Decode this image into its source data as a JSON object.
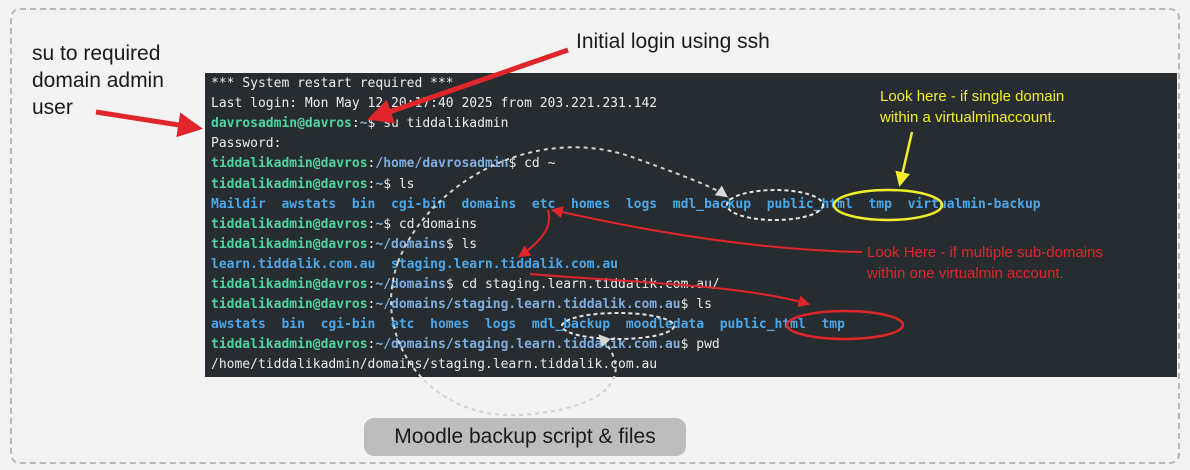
{
  "annotations": {
    "side_note": [
      "su to required",
      "domain admin",
      "user"
    ],
    "top_note": "Initial login using ssh",
    "yellow_note": [
      "Look here - if single domain",
      "within a virtualminaccount."
    ],
    "red_note": [
      "Look Here - if multiple sub-domains",
      "within one virtualmin account."
    ],
    "bottom_pill": "Moodle backup script & files"
  },
  "terminal": {
    "lines": [
      [
        {
          "t": "*** System restart required ***",
          "c": "plain"
        }
      ],
      [
        {
          "t": "Last login: Mon May 12 20:17:40 2025 from 203.221.231.142",
          "c": "plain"
        }
      ],
      [
        {
          "t": "davrosadmin@davros",
          "c": "prompt"
        },
        {
          "t": ":",
          "c": "plain"
        },
        {
          "t": "~",
          "c": "path"
        },
        {
          "t": "$ su tiddalikadmin",
          "c": "plain"
        }
      ],
      [
        {
          "t": "Password:",
          "c": "plain"
        }
      ],
      [
        {
          "t": "tiddalikadmin@davros",
          "c": "prompt"
        },
        {
          "t": ":",
          "c": "plain"
        },
        {
          "t": "/home/davrosadmin",
          "c": "path"
        },
        {
          "t": "$ cd ~",
          "c": "plain"
        }
      ],
      [
        {
          "t": "tiddalikadmin@davros",
          "c": "prompt"
        },
        {
          "t": ":",
          "c": "plain"
        },
        {
          "t": "~",
          "c": "path"
        },
        {
          "t": "$ ls",
          "c": "plain"
        }
      ],
      [
        {
          "t": "Maildir  awstats  bin  cgi-bin  domains  etc  homes  logs  mdl_backup  public_html  tmp  virtualmin-backup",
          "c": "dir"
        }
      ],
      [
        {
          "t": "tiddalikadmin@davros",
          "c": "prompt"
        },
        {
          "t": ":",
          "c": "plain"
        },
        {
          "t": "~",
          "c": "path"
        },
        {
          "t": "$ cd domains",
          "c": "plain"
        }
      ],
      [
        {
          "t": "tiddalikadmin@davros",
          "c": "prompt"
        },
        {
          "t": ":",
          "c": "plain"
        },
        {
          "t": "~/domains",
          "c": "path"
        },
        {
          "t": "$ ls",
          "c": "plain"
        }
      ],
      [
        {
          "t": "learn.tiddalik.com.au  staging.learn.tiddalik.com.au",
          "c": "dir"
        }
      ],
      [
        {
          "t": "tiddalikadmin@davros",
          "c": "prompt"
        },
        {
          "t": ":",
          "c": "plain"
        },
        {
          "t": "~/domains",
          "c": "path"
        },
        {
          "t": "$ cd staging.learn.tiddalik.com.au/",
          "c": "plain"
        }
      ],
      [
        {
          "t": "tiddalikadmin@davros",
          "c": "prompt"
        },
        {
          "t": ":",
          "c": "plain"
        },
        {
          "t": "~/domains/staging.learn.tiddalik.com.au",
          "c": "path"
        },
        {
          "t": "$ ls",
          "c": "plain"
        }
      ],
      [
        {
          "t": "awstats  bin  cgi-bin  etc  homes  logs  mdl_backup  moodledata  public_html  tmp",
          "c": "dir"
        }
      ],
      [
        {
          "t": "tiddalikadmin@davros",
          "c": "prompt"
        },
        {
          "t": ":",
          "c": "plain"
        },
        {
          "t": "~/domains/staging.learn.tiddalik.com.au",
          "c": "path"
        },
        {
          "t": "$ pwd",
          "c": "plain"
        }
      ],
      [
        {
          "t": "/home/tiddalikadmin/domains/staging.learn.tiddalik.com.au",
          "c": "plain"
        }
      ]
    ]
  },
  "colors": {
    "terminal_bg": "#272c30",
    "prompt": "#4ed6a2",
    "directory": "#4ba8ea",
    "arrow_red": "#e0262a",
    "highlight_yellow": "#f1ef2a",
    "dashed_white": "#e4e4e4"
  }
}
